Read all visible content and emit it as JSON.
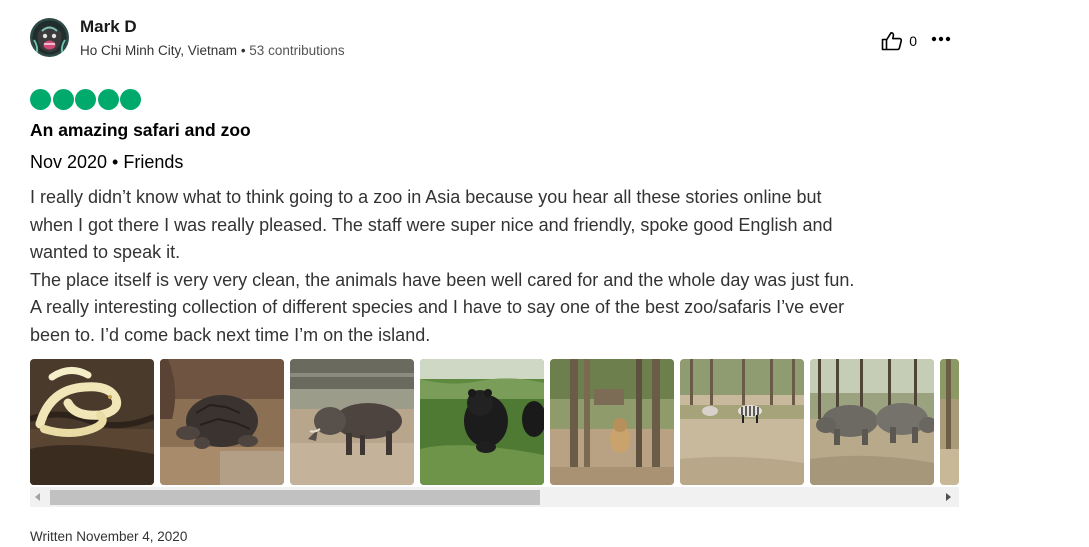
{
  "user": {
    "name": "Mark D",
    "location": "Ho Chi Minh City, Vietnam",
    "separator": " • ",
    "contributions": "53 contributions",
    "avatar_icon": "gorilla-avatar-icon"
  },
  "actions": {
    "helpful_count": "0",
    "helpful_icon": "thumbs-up-icon",
    "more_icon": "ellipsis-icon"
  },
  "rating": {
    "value": 5,
    "max": 5,
    "color": "#00aa6c"
  },
  "review": {
    "title": "An amazing safari and zoo",
    "visit_info": "Nov 2020 • Friends",
    "body_lines": [
      "I really didn’t know what to think going to a zoo in Asia because you hear all these stories online but",
      "when I got there I was really pleased. The staff were super nice and friendly, spoke good English and",
      "wanted to speak it.",
      "The place itself is very very clean, the animals have been well cared for and the whole day was just fun.",
      "A really interesting collection of different species and I have to say one of the best zoo/safaris I’ve ever",
      "been to. I’d come back next time I’m on the island."
    ],
    "written_date": "Written November 4, 2020"
  },
  "photos": [
    {
      "subject": "albino-python-photo"
    },
    {
      "subject": "tortoise-photo"
    },
    {
      "subject": "warthog-photo"
    },
    {
      "subject": "bear-photo"
    },
    {
      "subject": "lion-enclosure-photo"
    },
    {
      "subject": "zebra-photo"
    },
    {
      "subject": "rhino-photo"
    },
    {
      "subject": "partial-photo"
    }
  ],
  "gallery_scroll": {
    "visible_fraction": 0.53,
    "position_fraction": 0.0
  }
}
